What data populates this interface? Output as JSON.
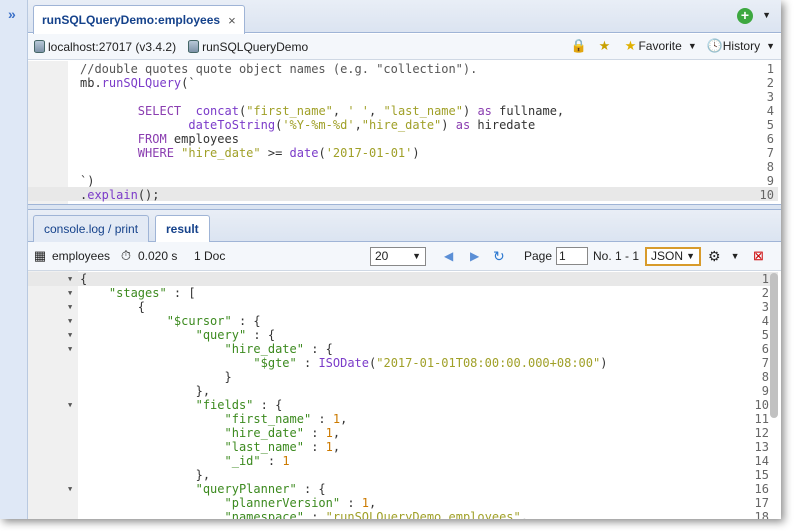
{
  "tab": {
    "title": "runSQLQueryDemo:employees",
    "close": "×"
  },
  "connection": {
    "host": "localhost:27017 (v3.4.2)",
    "database": "runSQLQueryDemo"
  },
  "toolbar": {
    "favorite": "Favorite",
    "history": "History"
  },
  "editor": {
    "lines": [
      {
        "n": "1",
        "text": "//double quotes quote object names (e.g. \"collection\")."
      },
      {
        "n": "2",
        "text": "mb.runSQLQuery(`"
      },
      {
        "n": "3",
        "text": ""
      },
      {
        "n": "4",
        "text": "        SELECT  concat(\"first_name\", ' ', \"last_name\") as fullname,"
      },
      {
        "n": "5",
        "text": "               dateToString('%Y-%m-%d',\"hire_date\") as hiredate"
      },
      {
        "n": "6",
        "text": "        FROM employees"
      },
      {
        "n": "7",
        "text": "        WHERE \"hire_date\" >= date('2017-01-01')"
      },
      {
        "n": "8",
        "text": ""
      },
      {
        "n": "9",
        "text": "`)"
      },
      {
        "n": "10",
        "text": ".explain();"
      }
    ]
  },
  "result_tabs": {
    "console": "console.log / print",
    "result": "result"
  },
  "result_toolbar": {
    "collection": "employees",
    "time": "0.020 s",
    "docs": "1 Doc",
    "page_size": "20",
    "page_label": "Page",
    "page_value": "1",
    "range": "No. 1 - 1",
    "format": "JSON"
  },
  "output": {
    "lines": [
      {
        "n": "1",
        "text": "{"
      },
      {
        "n": "2",
        "text": "    \"stages\" : ["
      },
      {
        "n": "3",
        "text": "        {"
      },
      {
        "n": "4",
        "text": "            \"$cursor\" : {"
      },
      {
        "n": "5",
        "text": "                \"query\" : {"
      },
      {
        "n": "6",
        "text": "                    \"hire_date\" : {"
      },
      {
        "n": "7",
        "text": "                        \"$gte\" : ISODate(\"2017-01-01T08:00:00.000+08:00\")"
      },
      {
        "n": "8",
        "text": "                    }"
      },
      {
        "n": "9",
        "text": "                },"
      },
      {
        "n": "10",
        "text": "                \"fields\" : {"
      },
      {
        "n": "11",
        "text": "                    \"first_name\" : 1,"
      },
      {
        "n": "12",
        "text": "                    \"hire_date\" : 1,"
      },
      {
        "n": "13",
        "text": "                    \"last_name\" : 1,"
      },
      {
        "n": "14",
        "text": "                    \"_id\" : 1"
      },
      {
        "n": "15",
        "text": "                },"
      },
      {
        "n": "16",
        "text": "                \"queryPlanner\" : {"
      },
      {
        "n": "17",
        "text": "                    \"plannerVersion\" : 1,"
      },
      {
        "n": "18",
        "text": "                    \"namespace\" : \"runSQLQueryDemo.employees\","
      }
    ]
  },
  "icons": [
    "expand-chevron-icon",
    "add-icon",
    "database-icon",
    "lock-icon",
    "favorite-star-icon",
    "history-icon",
    "table-icon",
    "timer-icon",
    "prev-icon",
    "next-icon",
    "refresh-icon",
    "settings-icon",
    "clear-icon"
  ]
}
